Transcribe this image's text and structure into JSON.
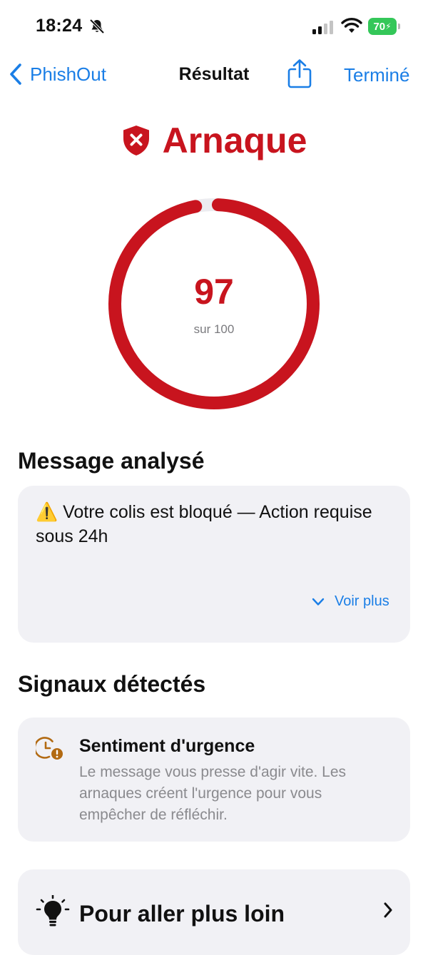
{
  "status_bar": {
    "time": "18:24",
    "battery": "70",
    "icons": [
      "bell-slash-icon",
      "cellular-signal-icon",
      "wifi-icon",
      "battery-charging-icon"
    ]
  },
  "nav": {
    "back_label": "PhishOut",
    "title": "Résultat",
    "done_label": "Terminé",
    "accent_color": "#1a7ee6"
  },
  "verdict": {
    "label": "Arnaque",
    "icon": "shield-x-icon",
    "color": "#c8141e"
  },
  "score": {
    "value": "97",
    "max_label": "sur 100",
    "fraction": 0.97
  },
  "message_section": {
    "title": "Message analysé",
    "text": "⚠️ Votre colis est bloqué — Action requise sous 24h",
    "see_more_label": "Voir plus"
  },
  "signals_section": {
    "title": "Signaux détectés",
    "items": [
      {
        "icon": "clock-alert-icon",
        "title": "Sentiment d'urgence",
        "description": "Le message vous presse d'agir vite. Les arnaques créent l'urgence pour vous empêcher de réfléchir."
      }
    ]
  },
  "more_section": {
    "icon": "lightbulb-icon",
    "title": "Pour aller plus loin"
  }
}
